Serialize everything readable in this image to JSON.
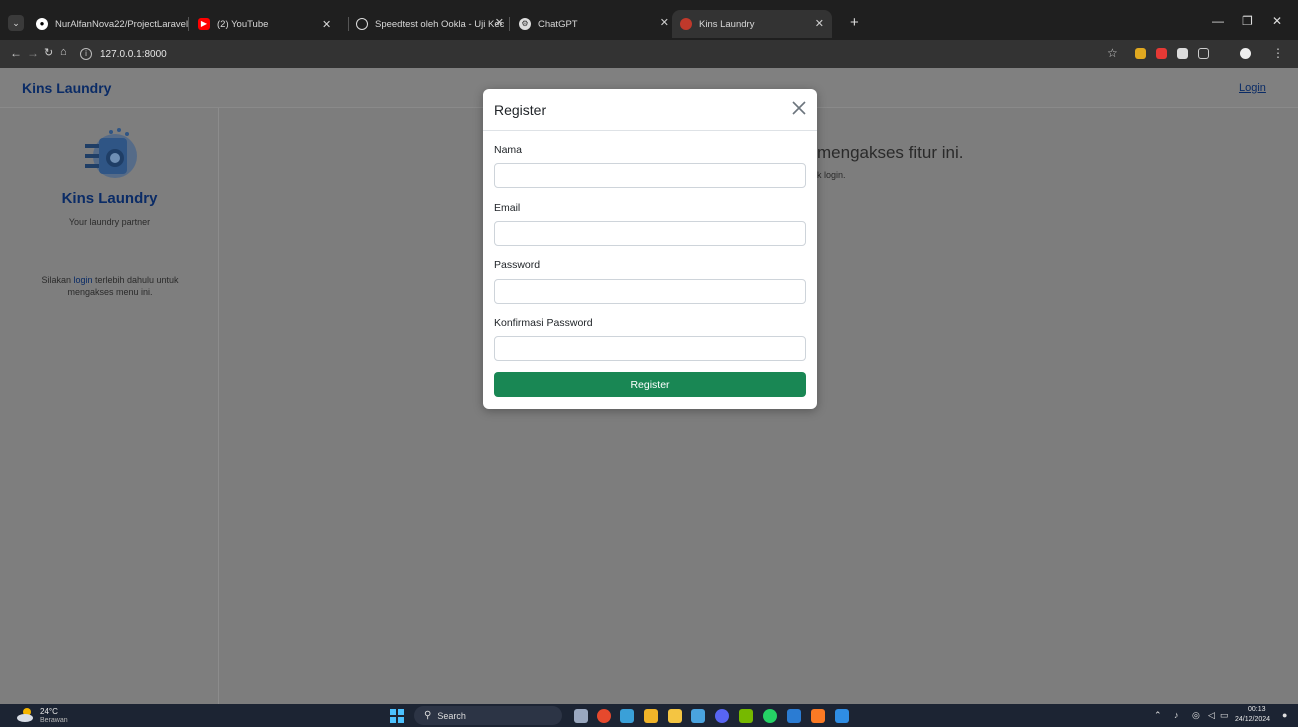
{
  "browser": {
    "tabs": [
      {
        "title": "NurAlfanNova22/ProjectLaravel",
        "favicon": "github-icon"
      },
      {
        "title": "(2) YouTube",
        "favicon": "youtube-icon"
      },
      {
        "title": "Speedtest oleh Ookla - Uji Kece",
        "favicon": "speedtest-icon"
      },
      {
        "title": "ChatGPT",
        "favicon": "chatgpt-icon"
      },
      {
        "title": "Kins Laundry",
        "favicon": "laundry-icon",
        "active": true
      }
    ],
    "url": "127.0.0.1:8000"
  },
  "navbar": {
    "brand": "Kins Laundry",
    "login_label": "Login"
  },
  "sidebar": {
    "title": "Kins Laundry",
    "tagline": "Your laundry partner",
    "msg_prefix": "Silakan ",
    "msg_link": "login",
    "msg_suffix": " terlebih dahulu untuk mengakses menu ini."
  },
  "main": {
    "message_fragment": "mengakses fitur ini.",
    "sub_fragment": "k login."
  },
  "modal": {
    "title": "Register",
    "fields": [
      {
        "label": "Nama",
        "value": ""
      },
      {
        "label": "Email",
        "value": ""
      },
      {
        "label": "Password",
        "value": ""
      },
      {
        "label": "Konfirmasi Password",
        "value": ""
      }
    ],
    "submit_label": "Register",
    "submit_color": "#198754"
  },
  "taskbar": {
    "weather_temp": "24°C",
    "weather_desc": "Berawan",
    "search_placeholder": "Search",
    "time": "00:13",
    "date": "24/12/2024"
  },
  "colors": {
    "brand": "#0a2b66",
    "overlay": "#7d7d7d"
  }
}
